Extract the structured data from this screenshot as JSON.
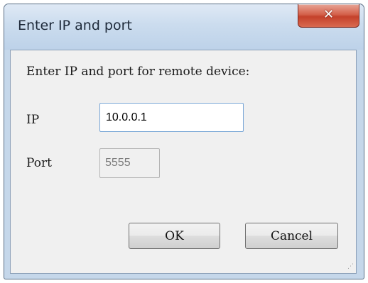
{
  "window": {
    "title": "Enter IP and port"
  },
  "titlebar": {
    "close_icon": "close-icon"
  },
  "dialog": {
    "instruction": "Enter IP and port for remote device:",
    "ip_label": "IP",
    "ip_value": "10.0.0.1",
    "port_label": "Port",
    "port_value": "5555",
    "port_enabled": false
  },
  "buttons": {
    "ok_label": "OK",
    "cancel_label": "Cancel"
  },
  "colors": {
    "titlebar": "#c5d7ea",
    "close_button": "#c4412b",
    "client_background": "#f0f0f0",
    "focus_border": "#7aa7d6"
  }
}
